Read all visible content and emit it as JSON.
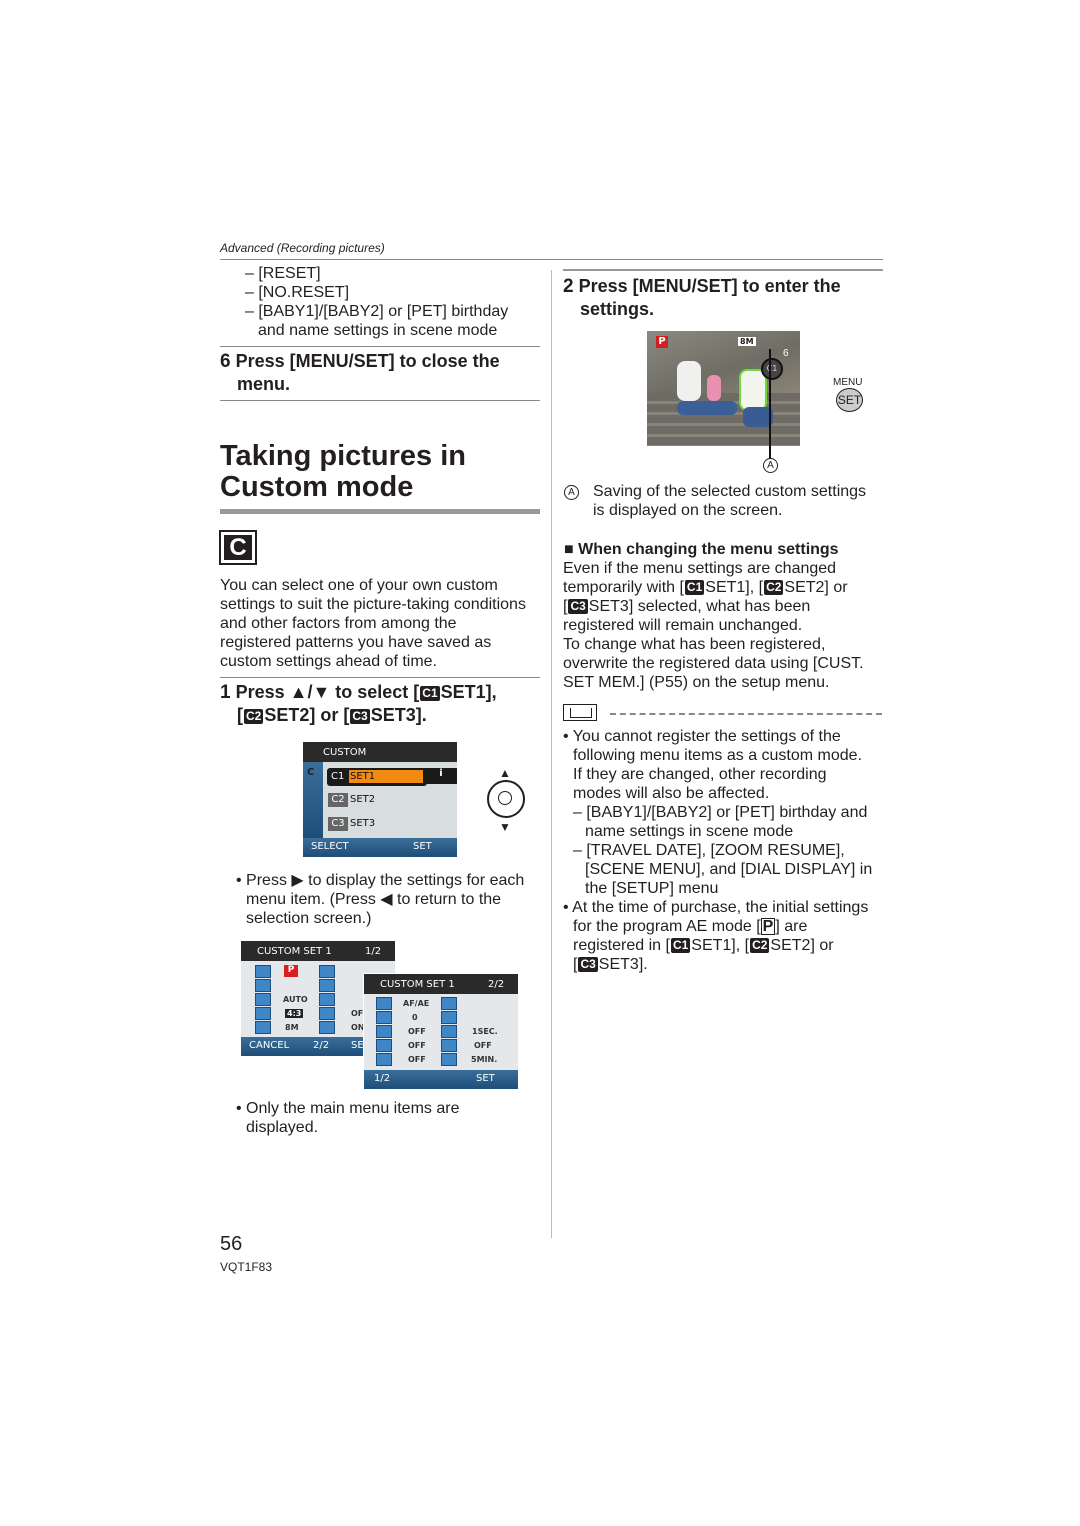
{
  "header": {
    "section": "Advanced (Recording pictures)"
  },
  "left": {
    "list": [
      "[RESET]",
      "[NO.RESET]",
      "[BABY1]/[BABY2] or [PET] birthday",
      "and name settings in scene mode"
    ],
    "step6": {
      "num": "6",
      "line1": "Press [MENU/SET] to close the",
      "line2": "menu."
    },
    "title": {
      "line1": "Taking pictures in",
      "line2": "Custom mode"
    },
    "mode_icon": "C",
    "intro": [
      "You can select one of your own custom",
      "settings to suit the picture-taking conditions",
      "and other factors from among the",
      "registered patterns you have saved as",
      "custom settings ahead of time."
    ],
    "step1": {
      "num": "1",
      "a": "Press ▲/▼ to select [",
      "c1": "C1",
      "b": "SET1],",
      "c": "[",
      "c2": "C2",
      "d": "SET2] or [",
      "c3": "C3",
      "e": "SET3]."
    },
    "custom_screen": {
      "title": "CUSTOM",
      "tab": "C",
      "items": [
        {
          "icon": "C1",
          "label": "SET1"
        },
        {
          "icon": "C2",
          "label": "SET2"
        },
        {
          "icon": "C3",
          "label": "SET3"
        }
      ],
      "info": "i",
      "footer_left": "SELECT",
      "footer_right": "SET"
    },
    "bullet1": [
      "Press ▶ to display the settings for each",
      "menu item. (Press ◀ to return to the",
      "selection screen.)"
    ],
    "set_screen1": {
      "title": "CUSTOM SET 1",
      "page": "1/2",
      "values1": [
        "P",
        "",
        "AUTO",
        "4:3",
        "8M"
      ],
      "values2": [
        "",
        "",
        "",
        "OFF",
        "ON"
      ],
      "footer_left": "CANCEL",
      "footer_mid": "2/2",
      "footer_right": "SE"
    },
    "set_screen2": {
      "title": "CUSTOM SET 1",
      "page": "2/2",
      "values1": [
        "AF/AE",
        "0",
        "OFF",
        "OFF",
        "OFF"
      ],
      "values2": [
        "",
        "",
        "1SEC.",
        "OFF",
        "5MIN."
      ],
      "footer_left": "1/2",
      "footer_right": "SET"
    },
    "bullet2": [
      "Only the main menu items are",
      "displayed."
    ],
    "page_number": "56",
    "code": "VQT1F83"
  },
  "right": {
    "step2": {
      "num": "2",
      "line1": "Press [MENU/SET] to enter the",
      "line2": "settings."
    },
    "photo": {
      "mode": "P",
      "indicator": "C1",
      "count": "6",
      "size": "8M"
    },
    "button": {
      "top": "MENU",
      "bottom": "SET"
    },
    "marker": "A",
    "caption": [
      "Saving of the selected custom settings",
      "is displayed on the screen."
    ],
    "subheading": "When changing the menu settings",
    "para": {
      "l1": "Even if the menu settings are changed",
      "l2a": "temporarily with [",
      "l2b": "SET1], [",
      "l2c": "SET2] or",
      "l3a": "[",
      "l3b": "SET3] selected, what has been",
      "l4": "registered will remain unchanged.",
      "l5": "To change what has been registered,",
      "l6": "overwrite the registered data using [CUST.",
      "l7": "SET MEM.] (P55) on the setup menu.",
      "c1": "C1",
      "c2": "C2",
      "c3": "C3"
    },
    "notes": {
      "n1": [
        "You cannot register the settings of the",
        "following menu items as a custom mode.",
        "If they are changed, other recording",
        "modes will also be affected."
      ],
      "d1": [
        "[BABY1]/[BABY2] or [PET] birthday and",
        "name settings in scene mode"
      ],
      "d2": [
        "[TRAVEL DATE], [ZOOM RESUME],",
        "[SCENE MENU], and [DIAL DISPLAY] in",
        "the [SETUP] menu"
      ],
      "n2a": "At the time of purchase, the initial settings",
      "n2b": "for the program AE mode [",
      "n2p": "P",
      "n2c": "] are",
      "n2d": "registered in [",
      "n2e": "SET1], [",
      "n2f": "SET2] or",
      "n2g": "[",
      "n2h": "SET3].",
      "c1": "C1",
      "c2": "C2",
      "c3": "C3"
    }
  }
}
